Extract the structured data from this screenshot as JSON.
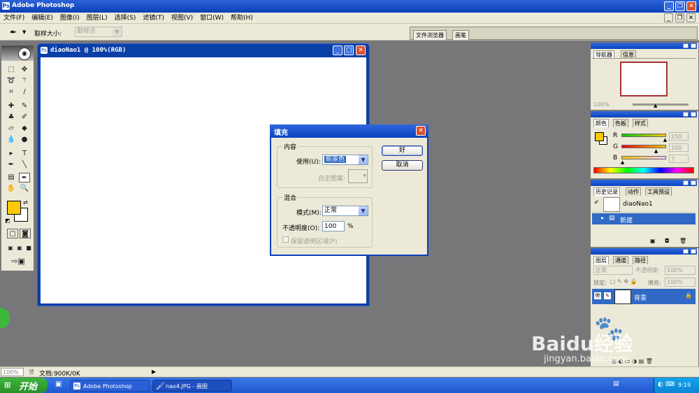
{
  "app": {
    "title": "Adobe Photoshop"
  },
  "menu": [
    "文件(F)",
    "编辑(E)",
    "图像(I)",
    "图层(L)",
    "选择(S)",
    "滤镜(T)",
    "视图(V)",
    "窗口(W)",
    "帮助(H)"
  ],
  "options_bar": {
    "sample_size_label": "取样大小:",
    "sample_size_value": "取样点",
    "tabs": [
      "文件浏览器",
      "画笔"
    ]
  },
  "document": {
    "title": "diaoNao1 @ 100%(RGB)"
  },
  "fill_dialog": {
    "title": "填充",
    "contents_group": "内容",
    "use_label": "使用(U):",
    "use_value": "前景色",
    "pattern_label": "自定图案:",
    "blend_group": "混合",
    "mode_label": "模式(M):",
    "mode_value": "正常",
    "opacity_label": "不透明度(O):",
    "opacity_value": "100",
    "opacity_unit": "%",
    "preserve_label": "保留透明区域(P)",
    "ok_label": "好",
    "cancel_label": "取消"
  },
  "navigator": {
    "tabs": [
      "导航器",
      "信息"
    ],
    "zoom": "100%"
  },
  "color_palette": {
    "tabs": [
      "颜色",
      "色板",
      "样式"
    ],
    "channels": [
      {
        "label": "R",
        "value": "250",
        "fraction": 0.98
      },
      {
        "label": "G",
        "value": "200",
        "fraction": 0.78
      },
      {
        "label": "B",
        "value": "7",
        "fraction": 0.03
      }
    ],
    "foreground_color": "#fac807",
    "background_color": "#ffffff"
  },
  "history": {
    "tabs": [
      "历史记录",
      "动作",
      "工具预设"
    ],
    "snapshot": "diaoNao1",
    "state": "新建"
  },
  "layers": {
    "tabs": [
      "图层",
      "通道",
      "路径"
    ],
    "blend_mode": "正常",
    "opacity_label": "不透明度:",
    "opacity_value": "100%",
    "lock_label": "锁定:",
    "fill_label": "填充:",
    "fill_value": "100%",
    "layer_name": "背景"
  },
  "status_bar": {
    "zoom": "100%",
    "doc_info": "文档:900K/0K"
  },
  "taskbar": {
    "start_label": "开始",
    "tasks": [
      "Adobe Photoshop",
      "nao4.JPG - 画图"
    ],
    "time": "9:19"
  },
  "watermark": {
    "brand": "Baidu经验",
    "url": "jingyan.baidu.com"
  },
  "accent_colors": {
    "titlebar": "#0b43c0",
    "selection": "#316ac5",
    "taskbar": "#2458d0"
  }
}
